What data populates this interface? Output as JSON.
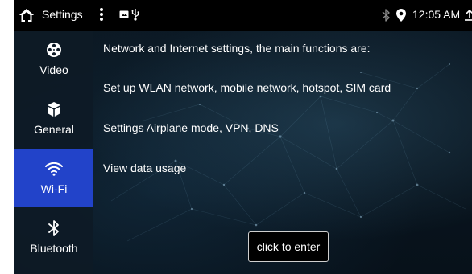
{
  "status_bar": {
    "title": "Settings",
    "time": "12:05 AM",
    "icons": [
      "home-icon",
      "more-vert-icon",
      "media-icon",
      "usb-icon",
      "bluetooth-icon",
      "location-icon",
      "upload-icon"
    ]
  },
  "sidebar": {
    "items": [
      {
        "label": "Video",
        "icon": "film-reel-icon",
        "active": false
      },
      {
        "label": "General",
        "icon": "cube-icon",
        "active": false
      },
      {
        "label": "Wi-Fi",
        "icon": "wifi-icon",
        "active": true
      },
      {
        "label": "Bluetooth",
        "icon": "bluetooth-icon",
        "active": false
      }
    ]
  },
  "main": {
    "lines": [
      "Network and Internet settings, the main functions are:",
      "Set up WLAN network, mobile network, hotspot, SIM card",
      "Settings Airplane mode, VPN, DNS",
      "View data usage"
    ],
    "enter_button": "click to enter"
  },
  "colors": {
    "active_item": "#2243c9",
    "status_bar_bg": "#000000",
    "background": "#0a1620"
  }
}
